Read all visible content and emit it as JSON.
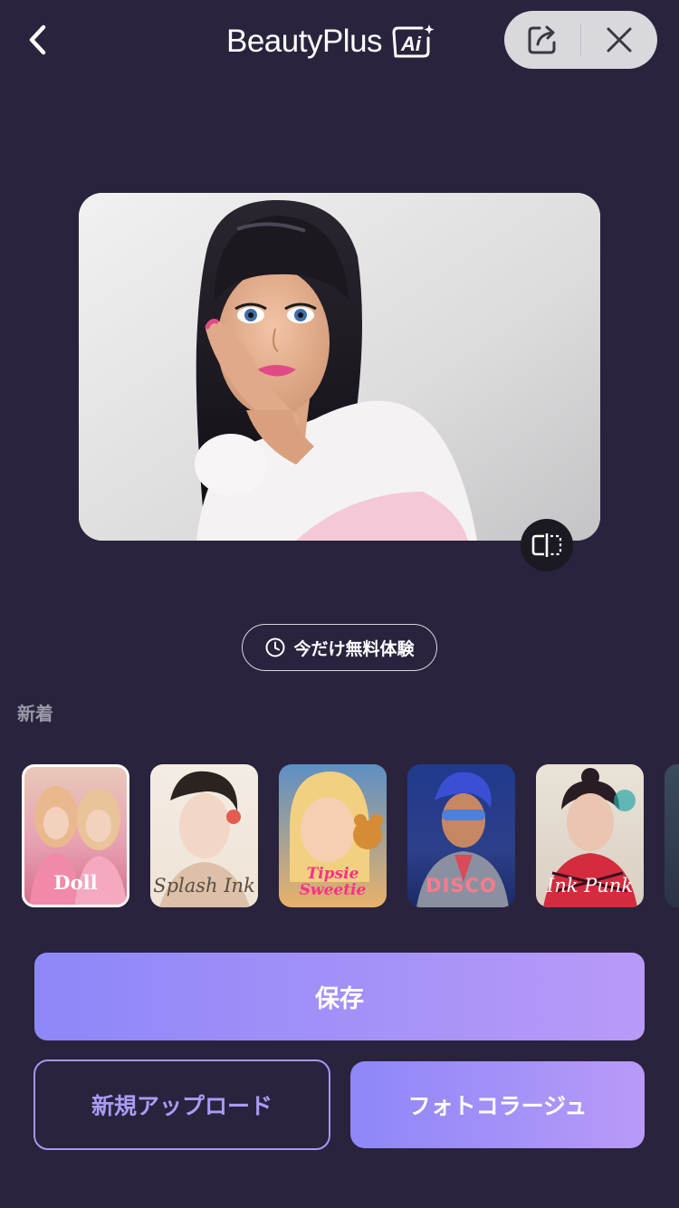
{
  "header": {
    "brand_name": "BeautyPlus",
    "brand_badge": "Ai",
    "icons": [
      "chevron-left-icon",
      "share-icon",
      "close-icon"
    ]
  },
  "trial": {
    "label": "今だけ無料体験",
    "icon": "clock-icon"
  },
  "section": {
    "title": "新着"
  },
  "styles": [
    {
      "name": "Doll",
      "selected": true
    },
    {
      "name": "Splash Ink",
      "selected": false
    },
    {
      "name": "Tipsie Sweetie",
      "selected": false
    },
    {
      "name": "DISCO",
      "selected": false
    },
    {
      "name": "Ink Punk",
      "selected": false
    }
  ],
  "actions": {
    "save_label": "保存",
    "upload_label": "新規アップロード",
    "collage_label": "フォトコラージュ"
  },
  "colors": {
    "background": "#29233d",
    "accent_start": "#8d87f8",
    "accent_end": "#b89af8"
  }
}
